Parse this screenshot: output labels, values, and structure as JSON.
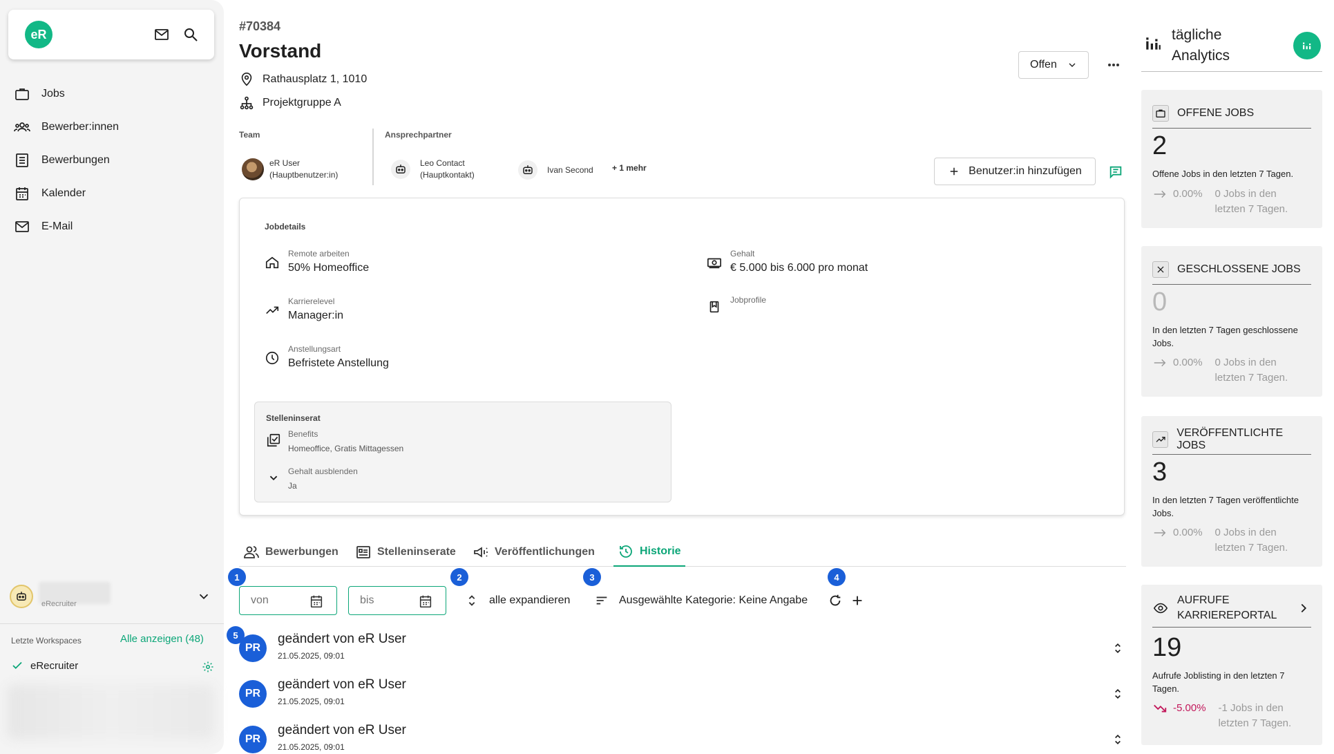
{
  "sidebar": {
    "logo": "eR",
    "nav": [
      "Jobs",
      "Bewerber:innen",
      "Bewerbungen",
      "Kalender",
      "E-Mail"
    ],
    "workspace_name": "eRecruiter",
    "recent_label": "Letzte Workspaces",
    "show_all": "Alle anzeigen (48)",
    "recent_item": "eRecruiter"
  },
  "job": {
    "id": "#70384",
    "title": "Vorstand",
    "address": "Rathausplatz 1, 1010",
    "group": "Projektgruppe A",
    "status": "Offen"
  },
  "team": {
    "label": "Team",
    "member_name": "eR User",
    "member_role": "(Hauptbenutzer:in)",
    "contact_label": "Ansprechpartner",
    "contact1_name": "Leo Contact",
    "contact1_role": "(Hauptkontakt)",
    "contact2_name": "Ivan Second",
    "more": "+ 1 mehr",
    "add_user": "Benutzer:in hinzufügen"
  },
  "details": {
    "title": "Jobdetails",
    "remote_label": "Remote arbeiten",
    "remote_value": "50% Homeoffice",
    "level_label": "Karrierelevel",
    "level_value": "Manager:in",
    "type_label": "Anstellungsart",
    "type_value": "Befristete Anstellung",
    "salary_label": "Gehalt",
    "salary_value": "€ 5.000 bis 6.000 pro monat",
    "profiles_label": "Jobprofile",
    "ad_title": "Stelleninserat",
    "benefits_label": "Benefits",
    "benefits_value": "Homeoffice, Gratis Mittagessen",
    "hide_salary_label": "Gehalt ausblenden",
    "hide_salary_value": "Ja"
  },
  "tabs": [
    "Bewerbungen",
    "Stelleninserate",
    "Veröffentlichungen",
    "Historie"
  ],
  "active_tab": "Historie",
  "filters": {
    "from_placeholder": "von",
    "to_placeholder": "bis",
    "expand_all": "alle expandieren",
    "category": "Ausgewählte Kategorie: Keine Angabe",
    "markers": [
      "1",
      "2",
      "3",
      "4",
      "5"
    ]
  },
  "history": [
    {
      "initials": "PR",
      "title": "geändert von eR User",
      "date": "21.05.2025, 09:01"
    },
    {
      "initials": "PR",
      "title": "geändert von eR User",
      "date": "21.05.2025, 09:01"
    },
    {
      "initials": "PR",
      "title": "geändert von eR User",
      "date": "21.05.2025, 09:01"
    }
  ],
  "analytics": {
    "title_line1": "tägliche",
    "title_line2": "Analytics",
    "cards": [
      {
        "title": "OFFENE JOBS",
        "value": "2",
        "desc": "Offene Jobs in den letzten 7 Tagen.",
        "pct": "0.00%",
        "note1": "0 Jobs in den",
        "note2": "letzten 7 Tagen."
      },
      {
        "title": "GESCHLOSSENE JOBS",
        "value": "0",
        "desc": "In den letzten 7 Tagen geschlossene Jobs.",
        "pct": "0.00%",
        "note1": "0 Jobs in den",
        "note2": "letzten 7 Tagen."
      },
      {
        "title": "VERÖFFENTLICHTE JOBS",
        "value": "3",
        "desc": "In den letzten 7 Tagen veröffentlichte Jobs.",
        "pct": "0.00%",
        "note1": "0 Jobs in den",
        "note2": "letzten 7 Tagen."
      },
      {
        "title_line1": "AUFRUFE",
        "title_line2": "KARRIEREPORTAL",
        "value": "19",
        "desc": "Aufrufe Joblisting in den letzten 7 Tagen.",
        "pct": "-5.00%",
        "note1": "-1 Jobs in den",
        "note2": "letzten 7 Tagen."
      }
    ],
    "negative_color": "#c2185b"
  },
  "colors": {
    "accent": "#0ca678",
    "brand": "#12b886",
    "marker": "#1a5fd8"
  }
}
